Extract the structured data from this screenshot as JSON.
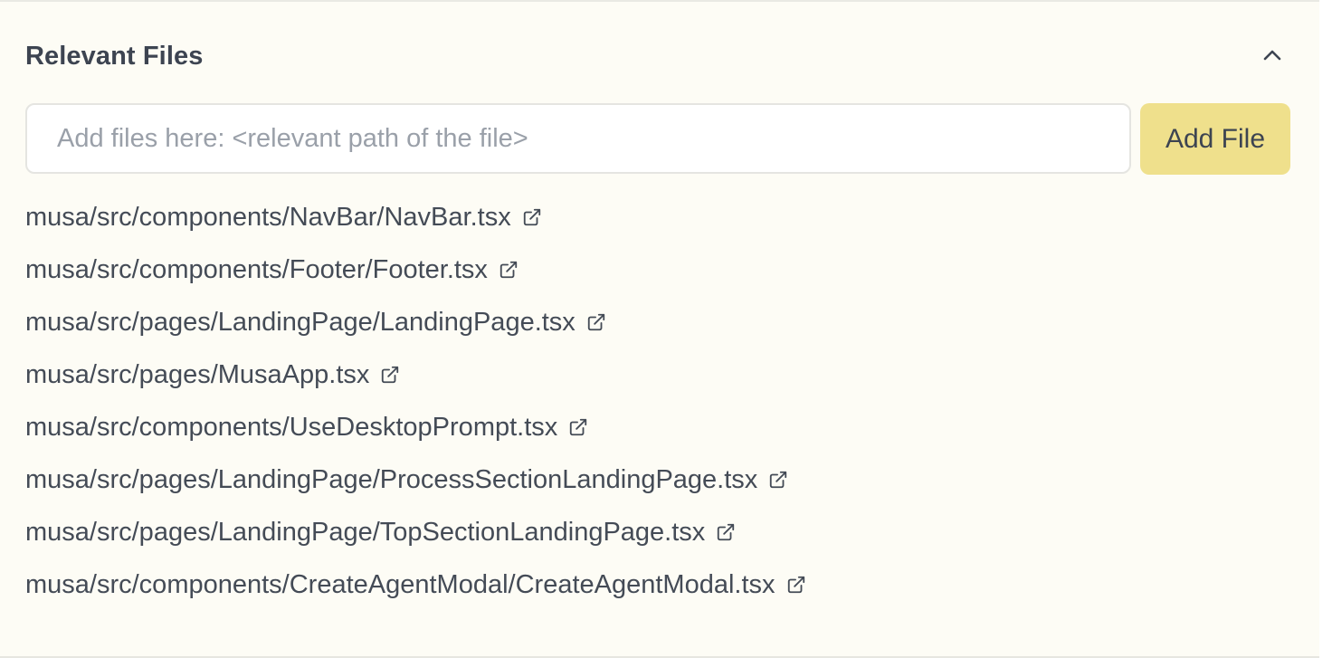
{
  "section": {
    "title": "Relevant Files",
    "collapse_icon": "chevron-up-icon"
  },
  "input": {
    "placeholder": "Add files here: <relevant path of the file>",
    "value": ""
  },
  "add_button": {
    "label": "Add File"
  },
  "files": [
    {
      "path": "musa/src/components/NavBar/NavBar.tsx",
      "icon": "external-link-icon"
    },
    {
      "path": "musa/src/components/Footer/Footer.tsx",
      "icon": "external-link-icon"
    },
    {
      "path": "musa/src/pages/LandingPage/LandingPage.tsx",
      "icon": "external-link-icon"
    },
    {
      "path": "musa/src/pages/MusaApp.tsx",
      "icon": "external-link-icon"
    },
    {
      "path": "musa/src/components/UseDesktopPrompt.tsx",
      "icon": "external-link-icon"
    },
    {
      "path": "musa/src/pages/LandingPage/ProcessSectionLandingPage.tsx",
      "icon": "external-link-icon"
    },
    {
      "path": "musa/src/pages/LandingPage/TopSectionLandingPage.tsx",
      "icon": "external-link-icon"
    },
    {
      "path": "musa/src/components/CreateAgentModal/CreateAgentModal.tsx",
      "icon": "external-link-icon"
    }
  ],
  "colors": {
    "panel_background": "#fdfcf5",
    "button_background": "#efe08c",
    "text": "#3d4451",
    "placeholder": "#9aa0a9"
  }
}
